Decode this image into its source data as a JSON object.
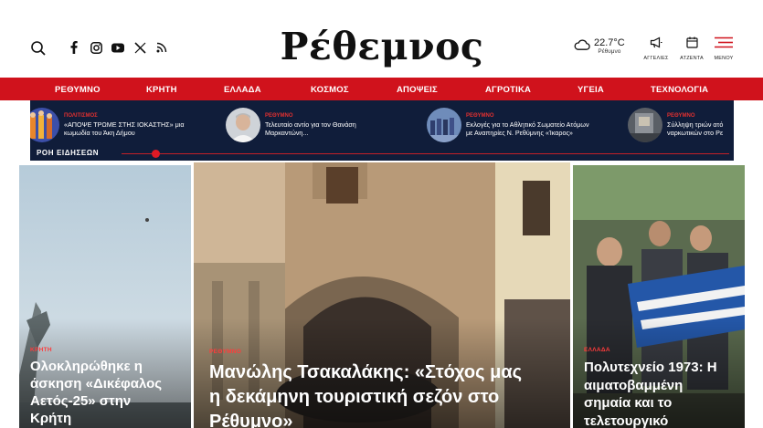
{
  "brand": {
    "logo_text": "Ρέθεμνος"
  },
  "header": {
    "weather": {
      "temp": "22.7°C",
      "location": "Ρέθυμνο"
    },
    "utilities": [
      {
        "label": "ΑΓΓΕΛΙΕΣ",
        "icon": "megaphone-icon"
      },
      {
        "label": "ΑΤΖΕΝΤΑ",
        "icon": "calendar-icon"
      },
      {
        "label": "ΜΕΝΟΥ",
        "icon": "hamburger-menu-icon"
      }
    ],
    "social_icons": [
      "facebook-icon",
      "instagram-icon",
      "youtube-icon",
      "x-icon",
      "rss-icon"
    ]
  },
  "nav": {
    "items": [
      "ΡΕΘΥΜΝΟ",
      "ΚΡΗΤΗ",
      "ΕΛΛΑΔΑ",
      "ΚΟΣΜΟΣ",
      "ΑΠΟΨΕΙΣ",
      "ΑΓΡΟΤΙΚΑ",
      "ΥΓΕΙΑ",
      "ΤΕΧΝΟΛΟΓΙΑ"
    ]
  },
  "ticker": {
    "label": "ΡΟΗ ΕΙΔΗΣΕΩΝ",
    "items": [
      {
        "category": "ΠΟΛΙΤΙΣΜΟΣ",
        "title_line1": "«ΑΠΟΨΕ ΤΡΩΜΕ ΣΤΗΣ ΙΟΚΑΣΤΗΣ» μια",
        "title_line2": "κωμωδία του Άκη Δήμου"
      },
      {
        "category": "ΡΕΘΥΜΝΟ",
        "title_line1": "Τελευταίο αντίο για τον Θανάση",
        "title_line2": "Μαρκαντώνη..."
      },
      {
        "category": "ΡΕΘΥΜΝΟ",
        "title_line1": "Εκλογές για το Αθλητικό Σωματείο Ατόμων",
        "title_line2": "με Αναπηρίες Ν. Ρεθύμνης «Ίκαρος»"
      },
      {
        "category": "ΡΕΘΥΜΝΟ",
        "title_line1": "Σύλληψη τριών ατό",
        "title_line2": "ναρκωτικών στο Ρε"
      }
    ]
  },
  "cards": [
    {
      "category": "ΚΡΗΤΗ",
      "title_lines": [
        "Ολοκληρώθηκε η",
        "άσκηση «Δικέφαλος",
        "Αετός-25» στην",
        "Κρήτη"
      ]
    },
    {
      "category": "ΡΕΘΥΜΝΟ",
      "title_lines": [
        "Μανώλης Τσακαλάκης: «Στόχος μας",
        "η δεκάμηνη τουριστική σεζόν στο",
        "Ρέθυμνο»"
      ]
    },
    {
      "category": "ΕΛΛΑΔΑ",
      "title_lines": [
        "Πολυτεχνείο 1973: Η",
        "αιματοβαμμένη",
        "σημαία και το",
        "τελετουργικό"
      ]
    }
  ],
  "colors": {
    "accent_red": "#d0121c",
    "ticker_bg": "#101d3a"
  }
}
